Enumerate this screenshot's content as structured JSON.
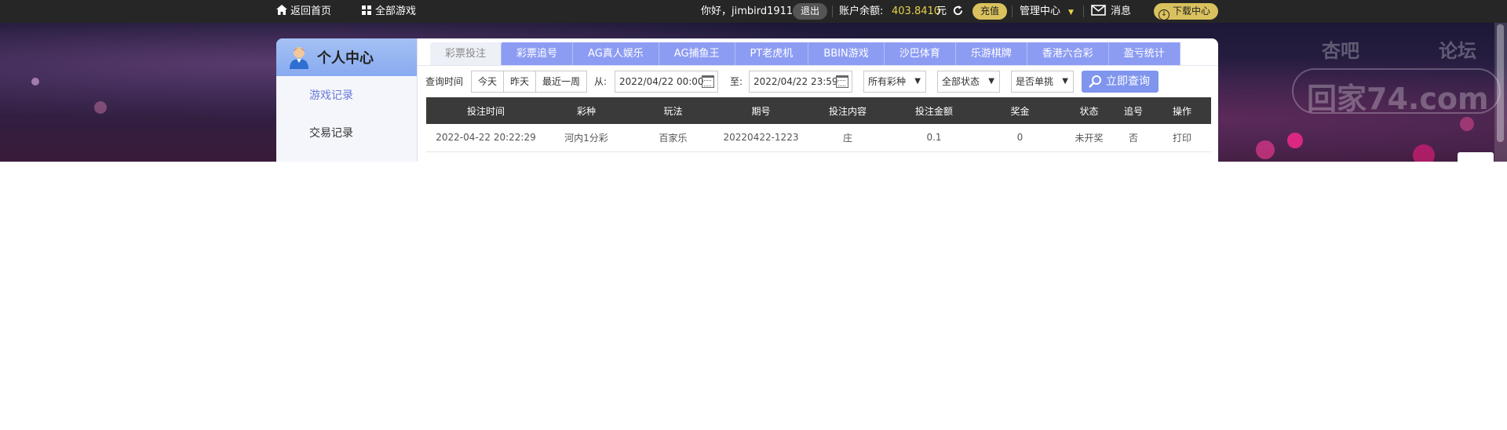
{
  "topbar": {
    "home": "返回首页",
    "all_games": "全部游戏",
    "greeting": "你好，jimbird1911",
    "logout": "退出",
    "balance_label": "账户余额:",
    "balance_value": "403.8410",
    "currency": "元",
    "recharge": "充值",
    "manage": "管理中心",
    "messages": "消息",
    "download": "下载中心"
  },
  "sidebar": {
    "title": "个人中心",
    "items": [
      "游戏记录",
      "交易记录"
    ]
  },
  "tabs": [
    "彩票投注",
    "彩票追号",
    "AG真人娱乐",
    "AG捕鱼王",
    "PT老虎机",
    "BBIN游戏",
    "沙巴体育",
    "乐游棋牌",
    "香港六合彩",
    "盈亏统计"
  ],
  "filters": {
    "time_label": "查询时间",
    "quick": [
      "今天",
      "昨天",
      "最近一周"
    ],
    "from_label": "从:",
    "from_value": "2022/04/22 00:00",
    "to_label": "至:",
    "to_value": "2022/04/22 23:59",
    "lottery_select": "所有彩种",
    "status_select": "全部状态",
    "single_select": "是否单挑",
    "query_button": "立即查询"
  },
  "table": {
    "headers": [
      "投注时间",
      "彩种",
      "玩法",
      "期号",
      "投注内容",
      "投注金额",
      "奖金",
      "状态",
      "追号",
      "操作"
    ],
    "rows": [
      [
        "2022-04-22 20:22:29",
        "河内1分彩",
        "百家乐",
        "20220422-1223",
        "庄",
        "0.1",
        "0",
        "未开奖",
        "否",
        "打印"
      ]
    ]
  },
  "watermark": {
    "line1": "杏吧",
    "line2": "论坛",
    "line3": "回家74.com"
  },
  "colors": {
    "accent": "#8d9cf3",
    "header_dark": "#262626",
    "balance": "#e8d24a",
    "recharge_bg": "#d9c25e"
  }
}
